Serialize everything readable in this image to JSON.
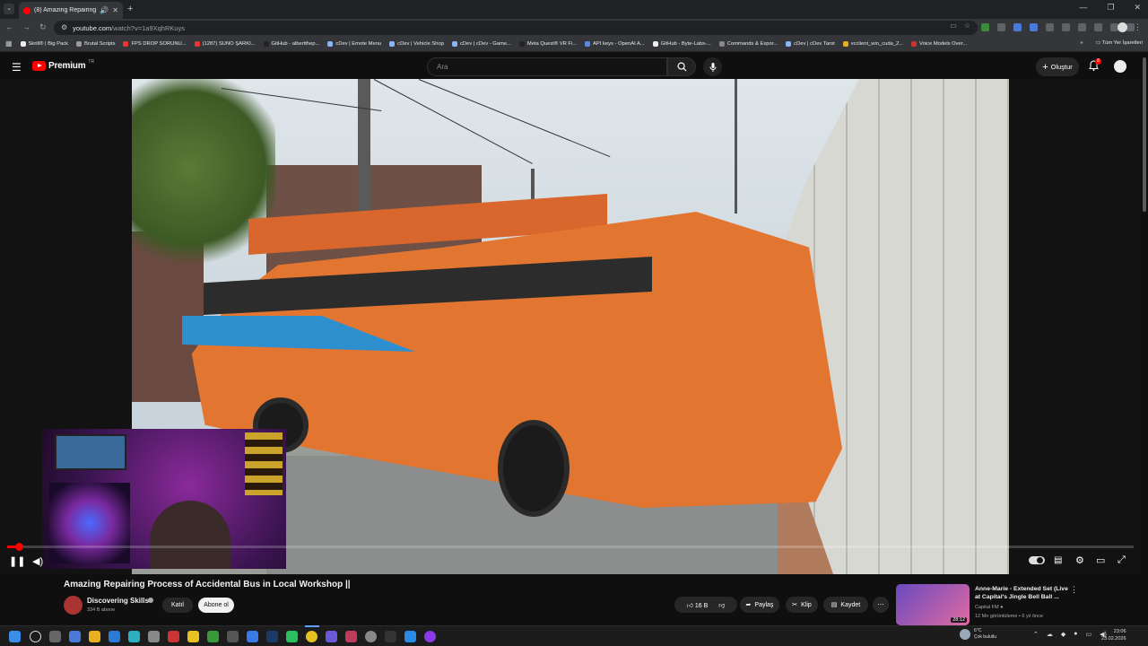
{
  "browser": {
    "tab_title": "(8) Amazing Repairing Proc",
    "url_host": "youtube.com",
    "url_path": "/watch?v=1a9XqhRKuys",
    "bookmarks": [
      "Skrill® | Big Pack",
      "Brutal Scripts",
      "FPS DROP SORUNU...",
      "(1287) SUNO ŞARKI...",
      "GitHub - albertthep...",
      "cDev | Emote Menu",
      "cDev | Vehicle Shop",
      "cDev | cDev - Game...",
      "Meta Quest® VR Fi...",
      "API keys - OpenAI A...",
      "GitHub - Byte-Labs-...",
      "Commands & Expor...",
      "cDev | cDev Tarot",
      "vcclient_win_cuda_2...",
      "Voice Models Over..."
    ],
    "all_bookmarks": "Tüm Yer İşaretleri"
  },
  "youtube": {
    "logo_text": "Premium",
    "logo_tm": "TR",
    "search_placeholder": "Ara",
    "create_label": "Oluştur",
    "notif_count": "8"
  },
  "video": {
    "title": "Amazing Repairing Process of Accidental Bus in Local Workshop ||",
    "channel": "Discovering Skills",
    "subscribers": "334 B abone",
    "join_label": "Katıl",
    "subscribe_label": "Abone ol",
    "likes": "16 B",
    "share_label": "Paylaş",
    "clip_label": "Klip",
    "save_label": "Kaydet",
    "progress": 0.01
  },
  "recommendation": {
    "title": "Anne-Marie - Extended Set (Live at Capital's Jingle Bell Ball ...",
    "channel": "Capital FM",
    "meta": "12 Mn görüntüleme • 6 yıl önce",
    "duration": "28:12"
  },
  "taskbar": {
    "weather_temp": "6°C",
    "weather_text": "Çok bulutlu",
    "time": "23:06",
    "date": "23.02.2026"
  }
}
